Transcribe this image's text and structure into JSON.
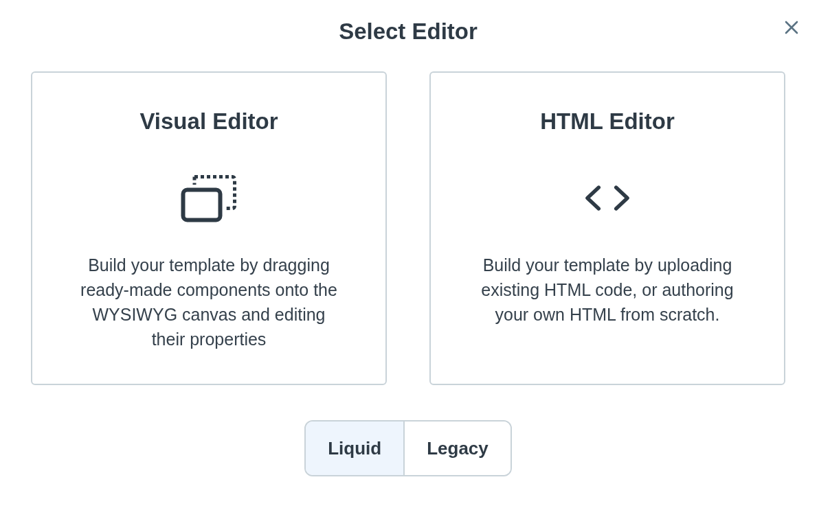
{
  "dialog": {
    "title": "Select Editor"
  },
  "editors": [
    {
      "kind": "visual",
      "title": "Visual Editor",
      "description": "Build your template by dragging ready-made components onto the WYSIWYG canvas and editing their properties"
    },
    {
      "kind": "code",
      "title": "HTML Editor",
      "description": "Build your template by uploading existing HTML code, or authoring your own HTML from scratch."
    }
  ],
  "template_languages": [
    {
      "label": "Liquid",
      "selected": true
    },
    {
      "label": "Legacy",
      "selected": false
    }
  ]
}
